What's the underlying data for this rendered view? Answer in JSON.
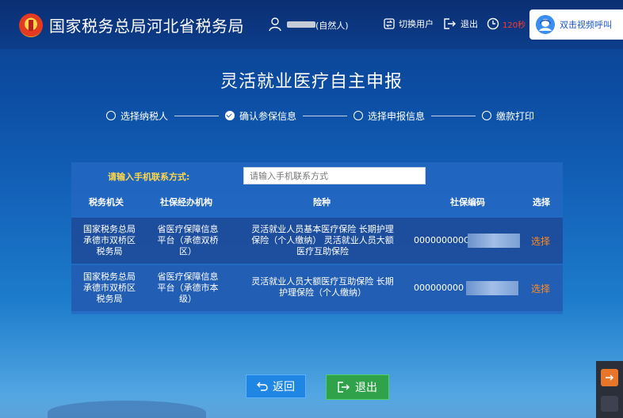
{
  "header": {
    "brand": "国家税务总局河北省税务局",
    "user_type": "(自然人)",
    "switch_user": "切换用户",
    "logout": "退出",
    "timer_seconds": "120秒",
    "video_call": "双击视频呼叫"
  },
  "page": {
    "title": "灵活就业医疗自主申报"
  },
  "steps": [
    {
      "label": "选择纳税人",
      "status": "pending"
    },
    {
      "label": "确认参保信息",
      "status": "done"
    },
    {
      "label": "选择申报信息",
      "status": "pending"
    },
    {
      "label": "缴款打印",
      "status": "pending"
    }
  ],
  "form": {
    "phone_label": "请输入手机联系方式:",
    "phone_placeholder": "请输入手机联系方式",
    "phone_value": ""
  },
  "table": {
    "columns": [
      "税务机关",
      "社保经办机构",
      "险种",
      "社保编码",
      "选择"
    ],
    "rows": [
      {
        "tax_authority": [
          "国家税务总局",
          "承德市双桥区",
          "税务局"
        ],
        "agency": [
          "省医疗保障信息",
          "平台（承德双桥",
          "区）"
        ],
        "insurance": [
          "灵活就业人员基本医疗保险  长期护理",
          "保险（个人缴纳）  灵活就业人员大额",
          "医疗互助保险"
        ],
        "code": "000000000C",
        "select": "选择"
      },
      {
        "tax_authority": [
          "国家税务总局",
          "承德市双桥区",
          "税务局"
        ],
        "agency": [
          "省医疗保障信息",
          "平台（承德市本",
          "级）"
        ],
        "insurance": [
          "灵活就业人员大额医疗互助保险  长期",
          "护理保险（个人缴纳）"
        ],
        "code": "000000000",
        "select": "选择"
      }
    ]
  },
  "actions": {
    "back": "返回",
    "exit": "退出"
  },
  "icons": {
    "emblem": "tax-emblem-icon",
    "user": "user-icon",
    "switch_user": "switch-user-icon",
    "logout": "logout-icon",
    "timer": "clock-icon",
    "video": "customer-service-icon",
    "back": "undo-icon",
    "exit": "exit-icon"
  }
}
